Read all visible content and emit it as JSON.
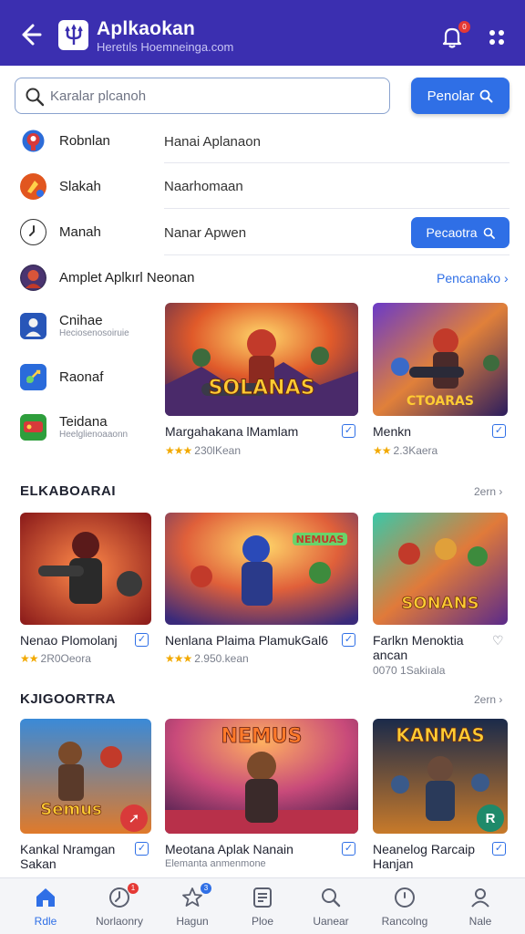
{
  "header": {
    "title": "Aplkaokan",
    "subtitle": "Heretıls Hoemneinga.com",
    "notification_count": "0",
    "colors": {
      "bar": "#3b2fb0",
      "accent": "#2f6fe6"
    }
  },
  "search": {
    "placeholder": "Karalar plcanoh",
    "button_label": "Penolar"
  },
  "categories": [
    {
      "label": "Robnlan",
      "sub": "",
      "icon": "red-circle-icon"
    },
    {
      "label": "Slakah",
      "sub": "",
      "icon": "orange-game-icon"
    },
    {
      "label": "Manah",
      "sub": "",
      "icon": "clock-icon"
    },
    {
      "label": "Amplet Aplkırl Neonan",
      "sub": "",
      "icon": "hero-avatar-icon"
    },
    {
      "label": "Cnihae",
      "sub": "Heciosenosoiruie",
      "icon": "blue-hero-icon"
    },
    {
      "label": "Raonaf",
      "sub": "",
      "icon": "blue-shield-icon"
    },
    {
      "label": "Teidana",
      "sub": "Heelglienoaaonn",
      "icon": "green-red-game-icon"
    }
  ],
  "rows": [
    {
      "text": "Hanai Aplanaon"
    },
    {
      "text": "Naarhomaan"
    },
    {
      "text": "Nanar Apwen",
      "button_label": "Pecaotra"
    }
  ],
  "more_link": "Pencanako",
  "featured": [
    {
      "title": "Margahakana lMamlam",
      "rating": "2,5",
      "meta": "230lKean",
      "art_title": "SOLANAS"
    },
    {
      "title": "Menkn",
      "rating": "2",
      "meta": "2.3Kaera",
      "art_title": "CTOARAS"
    }
  ],
  "section1": {
    "title": "ELKABOARAI",
    "more": "2ern",
    "cards": [
      {
        "title": "Nenao Plomolanj",
        "rating": "2,5",
        "meta": "2R0Oeora",
        "art_title": ""
      },
      {
        "title": "Nenlana Plaima PlamukGal6",
        "rating": "2,5",
        "meta": "2.950.kean",
        "art_title": "NEMUAS"
      },
      {
        "title": "Farlkn Menoktia ancan",
        "rating": "0,5",
        "meta": "0070 1Sakiıala",
        "art_title": "SONANS"
      }
    ]
  },
  "section2": {
    "title": "KJIGOORTRA",
    "more": "2ern",
    "cards": [
      {
        "title": "Kankal Nramgan Sakan",
        "art_title": "Semus",
        "badge": "add-icon"
      },
      {
        "title": "Meotana Aplak Nanain",
        "sub": "Elemanta anmenmone",
        "art_title": "NEMUS"
      },
      {
        "title": "Neanelog Rarcaip Hanjan",
        "art_title": "KANMAS",
        "badge": "badge-r-icon"
      }
    ]
  },
  "bottom_nav": [
    {
      "label": "Rdle",
      "icon": "home-icon",
      "active": true
    },
    {
      "label": "Norlaonry",
      "icon": "history-icon",
      "badge": "1"
    },
    {
      "label": "Hagun",
      "icon": "star-icon",
      "badge": "3"
    },
    {
      "label": "Ploe",
      "icon": "list-icon"
    },
    {
      "label": "Uanear",
      "icon": "search-icon"
    },
    {
      "label": "Rancolng",
      "icon": "ranking-icon"
    },
    {
      "label": "Nale",
      "icon": "profile-icon"
    }
  ]
}
